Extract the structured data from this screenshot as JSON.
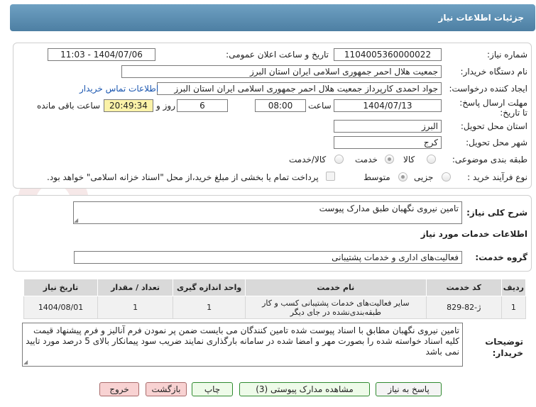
{
  "header": {
    "title": "جزئیات اطلاعات نیاز"
  },
  "form": {
    "need_number_label": "شماره نیاز:",
    "need_number": "1104005360000022",
    "announce_label": "تاریخ و ساعت اعلان عمومی:",
    "announce_value": "1404/07/06 - 11:03",
    "buyer_label": "نام دستگاه خریدار:",
    "buyer_value": "جمعیت هلال احمر جمهوری اسلامی ایران استان البرز",
    "creator_label": "ایجاد کننده درخواست:",
    "creator_value": "جواد احمدی کارپرداز جمعیت هلال احمر جمهوری اسلامی ایران استان البرز",
    "contact_link": "اطلاعات تماس خریدار",
    "deadline_label": "مهلت ارسال پاسخ: تا تاریخ:",
    "deadline_date": "1404/07/13",
    "time_label": "ساعت",
    "deadline_time": "08:00",
    "days_value": "6",
    "days_label": "روز و",
    "remaining_value": "20:49:34",
    "remaining_label": "ساعت باقی مانده",
    "province_label": "استان محل تحویل:",
    "province_value": "البرز",
    "city_label": "شهر محل تحویل:",
    "city_value": "کرج",
    "category_label": "طبقه بندی موضوعی:",
    "category_options": [
      "کالا",
      "خدمت",
      "کالا/خدمت"
    ],
    "category_selected": "خدمت",
    "purchase_type_label": "نوع فرآیند خرید :",
    "purchase_options": [
      "جزیی",
      "متوسط"
    ],
    "purchase_selected": "متوسط",
    "payment_note": "پرداخت تمام یا بخشی از مبلغ خرید،از محل \"اسناد خزانه اسلامی\" خواهد بود."
  },
  "summary": {
    "label": "شرح کلی نیاز:",
    "value": "تامین نیروی نگهبان طبق مدارک پیوست"
  },
  "services": {
    "section_title": "اطلاعات خدمات مورد نیاز",
    "group_label": "گروه خدمت:",
    "group_value": "فعالیت‌های اداری و خدمات پشتیبانی"
  },
  "table": {
    "headers": [
      "ردیف",
      "کد خدمت",
      "نام خدمت",
      "واحد اندازه گیری",
      "تعداد / مقدار",
      "تاریخ نیاز"
    ],
    "rows": [
      [
        "1",
        "ژ-82-829",
        "سایر فعالیت‌های خدمات پشتیبانی کسب و کار طبقه‌بندی‌نشده در جای دیگر",
        "1",
        "1",
        "1404/08/01"
      ]
    ]
  },
  "buyer_notes": {
    "label": "توضیحات خریدار:",
    "value": "تامین نیروی نگهبان مطابق با اسناد پیوست شده تامین کنندگان می بایست ضمن پر نمودن فرم آنالیز و فرم پیشنهاد قیمت کلیه اسناد خواسته شده را بصورت مهر و امضا شده در سامانه بارگذاری نمایند ضریب سود پیمانکار بالای 5 درصد مورد تایید نمی باشد"
  },
  "buttons": {
    "reply": "پاسخ به نیاز",
    "view_docs": "مشاهده مدارک پیوستی (3)",
    "print": "چاپ",
    "back": "بازگشت",
    "exit": "خروج"
  }
}
